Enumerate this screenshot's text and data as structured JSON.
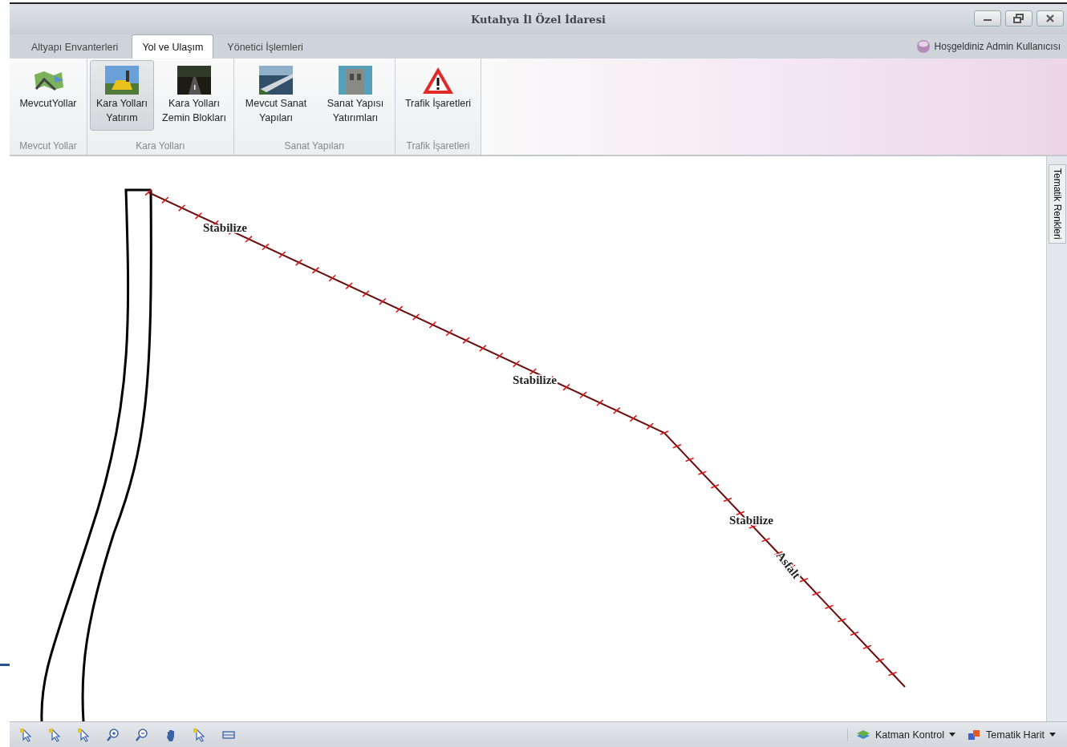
{
  "window": {
    "title": "Kutahya İl Özel İdaresi"
  },
  "tabs": [
    {
      "label": "Altyapı Envanterleri",
      "selected": false
    },
    {
      "label": "Yol ve Ulaşım",
      "selected": true
    },
    {
      "label": "Yönetici İşlemleri",
      "selected": false
    }
  ],
  "welcome": "Hoşgeldiniz Admin Kullanıcısı",
  "ribbon_groups": [
    {
      "label": "Mevcut Yollar",
      "buttons": [
        {
          "label": "MevcutYollar",
          "selected": false
        }
      ]
    },
    {
      "label": "Kara Yolları",
      "buttons": [
        {
          "label": "Kara Yolları Yatırım",
          "selected": true
        },
        {
          "label": "Kara Yolları Zemin Blokları",
          "selected": false
        }
      ]
    },
    {
      "label": "Sanat Yapıları",
      "buttons": [
        {
          "label": "Mevcut Sanat Yapıları",
          "selected": false
        },
        {
          "label": "Sanat Yapısı Yatırımları",
          "selected": false
        }
      ]
    },
    {
      "label": "Trafik İşaretleri",
      "buttons": [
        {
          "label": "Trafik İşaretleri",
          "selected": false
        }
      ]
    }
  ],
  "map_labels": [
    "Stabilize",
    "Stabilize",
    "Stabilize",
    "Asfalt"
  ],
  "side_tab": "Tematik Renkleri",
  "status_bar": {
    "dropdowns": [
      "Katman Kontrol",
      "Tematik Harit"
    ]
  }
}
